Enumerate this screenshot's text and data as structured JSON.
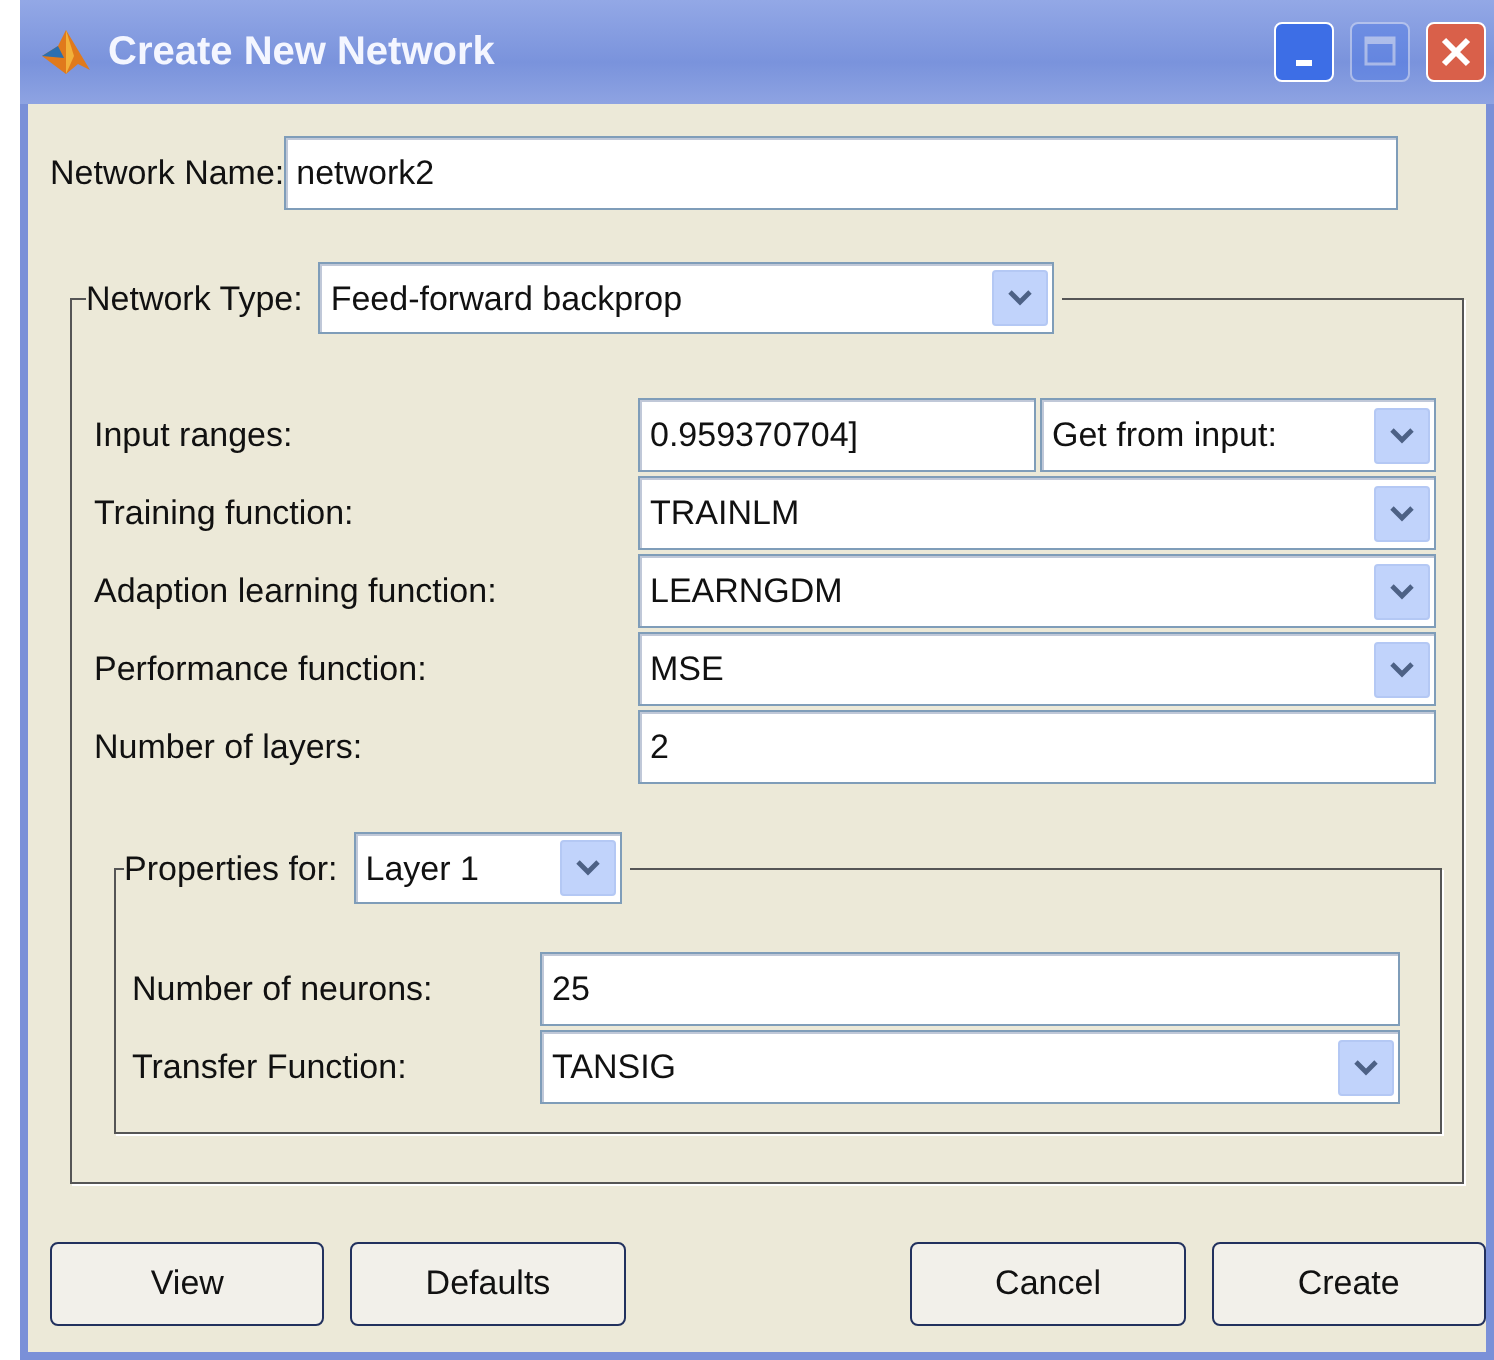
{
  "window": {
    "title": "Create New Network",
    "controls": [
      {
        "kind": "minimize",
        "disabled": false
      },
      {
        "kind": "maximize",
        "disabled": true
      },
      {
        "kind": "close",
        "disabled": false
      }
    ]
  },
  "network_name": {
    "label": "Network Name:",
    "value": "network2"
  },
  "network_type": {
    "label": "Network Type:",
    "value": "Feed-forward backprop",
    "fields": [
      {
        "kind": "range",
        "label": "Input ranges:",
        "value": "0.959370704]",
        "option": "Get from input:"
      },
      {
        "kind": "dropdown",
        "label": "Training function:",
        "value": "TRAINLM"
      },
      {
        "kind": "dropdown",
        "label": "Adaption learning function:",
        "value": "LEARNGDM"
      },
      {
        "kind": "dropdown",
        "label": "Performance function:",
        "value": "MSE"
      },
      {
        "kind": "text",
        "label": "Number of layers:",
        "value": "2"
      }
    ],
    "properties": {
      "label": "Properties for:",
      "value": "Layer 1",
      "fields": [
        {
          "kind": "text",
          "label": "Number of neurons:",
          "value": "25"
        },
        {
          "kind": "dropdown",
          "label": "Transfer Function:",
          "value": "TANSIG"
        }
      ]
    }
  },
  "left_buttons": [
    {
      "label": "View"
    },
    {
      "label": "Defaults"
    }
  ],
  "right_buttons": [
    {
      "label": "Cancel"
    },
    {
      "label": "Create"
    }
  ]
}
